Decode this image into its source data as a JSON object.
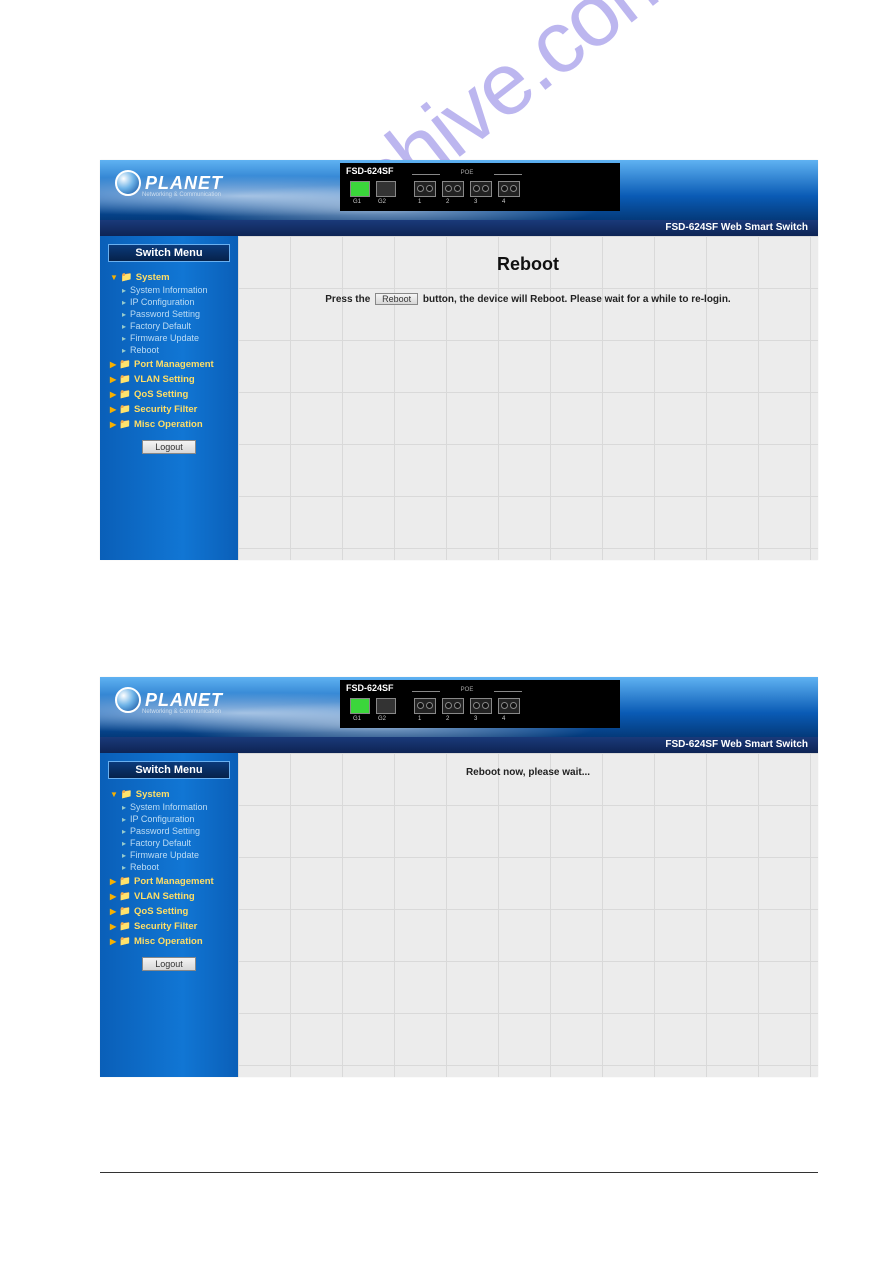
{
  "device": {
    "brand": "PLANET",
    "tagline": "Networking & Communication",
    "model": "FSD-624SF",
    "poe_label": "POE",
    "port_labels_g": [
      "G1",
      "G2"
    ],
    "port_labels_f": [
      "1",
      "2",
      "3",
      "4"
    ]
  },
  "titlebar": "FSD-624SF Web Smart Switch",
  "sidebar": {
    "menu_header": "Switch Menu",
    "groups": [
      {
        "label": "System",
        "expanded": true,
        "items": [
          "System Information",
          "IP Configuration",
          "Password Setting",
          "Factory Default",
          "Firmware Update",
          "Reboot"
        ]
      },
      {
        "label": "Port Management"
      },
      {
        "label": "VLAN Setting"
      },
      {
        "label": "QoS Setting"
      },
      {
        "label": "Security Filter"
      },
      {
        "label": "Misc Operation"
      }
    ],
    "logout": "Logout"
  },
  "panel1": {
    "title": "Reboot",
    "text_before": "Press the",
    "button": "Reboot",
    "text_after": "button, the device will Reboot.  Please wait for a while to re-login."
  },
  "panel2": {
    "message": "Reboot now, please wait..."
  },
  "watermark": "manualshive.com"
}
